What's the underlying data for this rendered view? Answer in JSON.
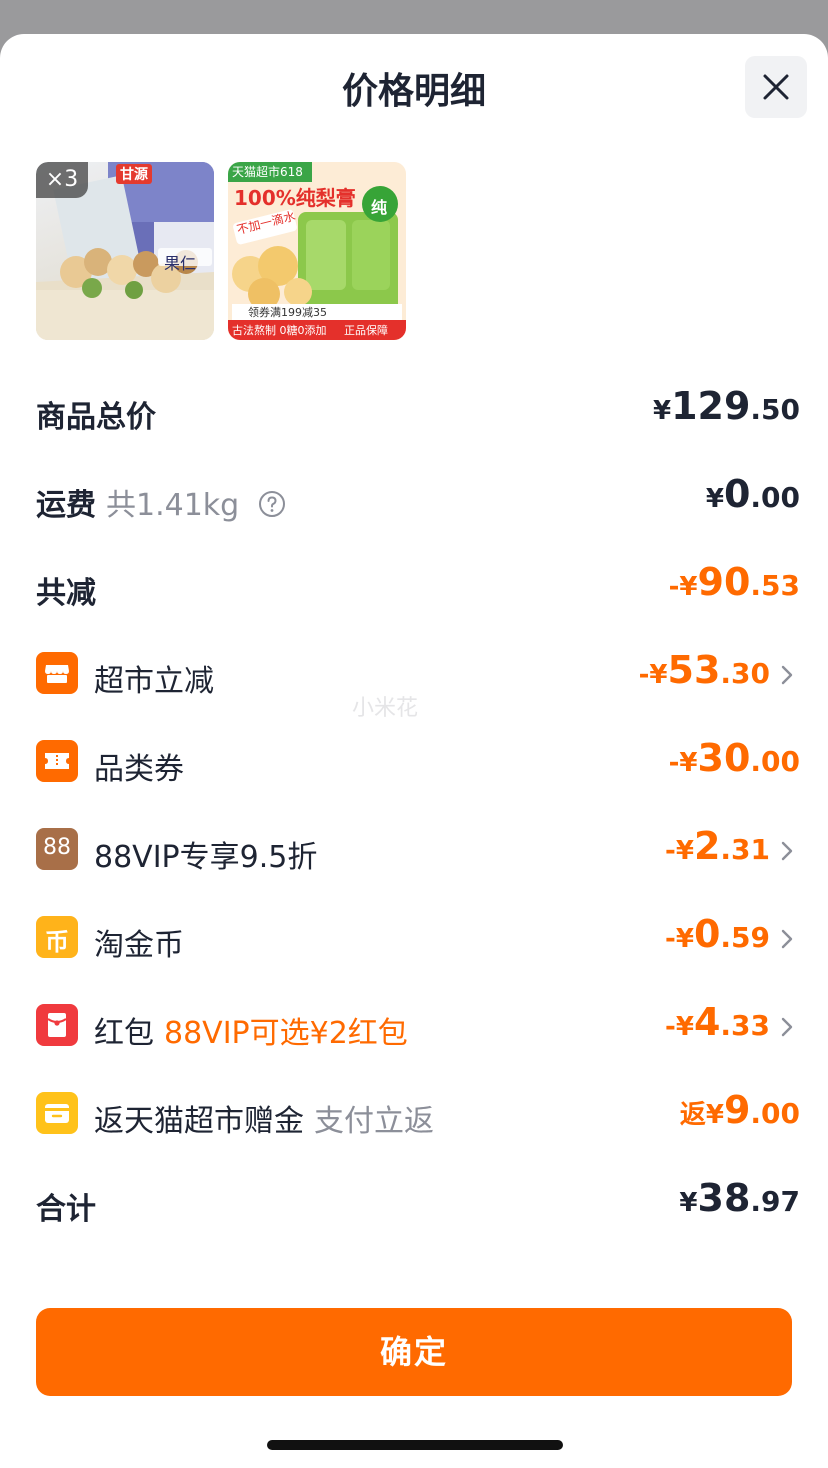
{
  "sheet": {
    "title": "价格明细",
    "watermark": "小米花"
  },
  "products": [
    {
      "quantity_badge": "×3",
      "brand_text": "甘源",
      "label_text": "果仁"
    },
    {
      "banner_text": "天猫超市618",
      "headline": "100%纯梨膏",
      "tag": "不加一滴水",
      "coupon": "领券满199减35",
      "footer_left": "古法熬制 0糖0添加",
      "footer_right": "正品保障",
      "badge": "纯"
    }
  ],
  "summary": {
    "goods_total": {
      "label": "商品总价",
      "currency": "¥",
      "int": "129",
      "dec": ".50"
    },
    "shipping": {
      "label": "运费",
      "note": "共1.41kg",
      "currency": "¥",
      "int": "0",
      "dec": ".00"
    },
    "total_discount": {
      "label": "共减",
      "currency": "-¥",
      "int": "90",
      "dec": ".53"
    }
  },
  "discounts": [
    {
      "label": "超市立减",
      "currency": "-¥",
      "int": "53",
      "dec": ".30",
      "icon": "store-icon",
      "has_arrow": true
    },
    {
      "label": "品类券",
      "currency": "-¥",
      "int": "30",
      "dec": ".00",
      "icon": "ticket-icon",
      "has_arrow": false
    },
    {
      "label": "88VIP专享9.5折",
      "currency": "-¥",
      "int": "2",
      "dec": ".31",
      "icon": "vip88-icon",
      "icon_text": "88",
      "has_arrow": true
    },
    {
      "label": "淘金币",
      "currency": "-¥",
      "int": "0",
      "dec": ".59",
      "icon": "coin-icon",
      "icon_text": "币",
      "has_arrow": true
    },
    {
      "label": "红包",
      "note": "88VIP可选¥2红包",
      "currency": "-¥",
      "int": "4",
      "dec": ".33",
      "icon": "red-envelope-icon",
      "has_arrow": true
    },
    {
      "label": "返天猫超市赠金",
      "note": "支付立返",
      "currency": "返¥",
      "int": "9",
      "dec": ".00",
      "icon": "wallet-icon",
      "has_arrow": false
    }
  ],
  "grand_total": {
    "label": "合计",
    "currency": "¥",
    "int": "38",
    "dec": ".97"
  },
  "confirm_button": {
    "label": "确定"
  },
  "colors": {
    "accent": "#ff6a00",
    "text": "#1e2433",
    "muted": "#8c8f99",
    "red_envelope": "#f03a3e",
    "gold": "#ffb31a",
    "vip": "#a86f48"
  }
}
